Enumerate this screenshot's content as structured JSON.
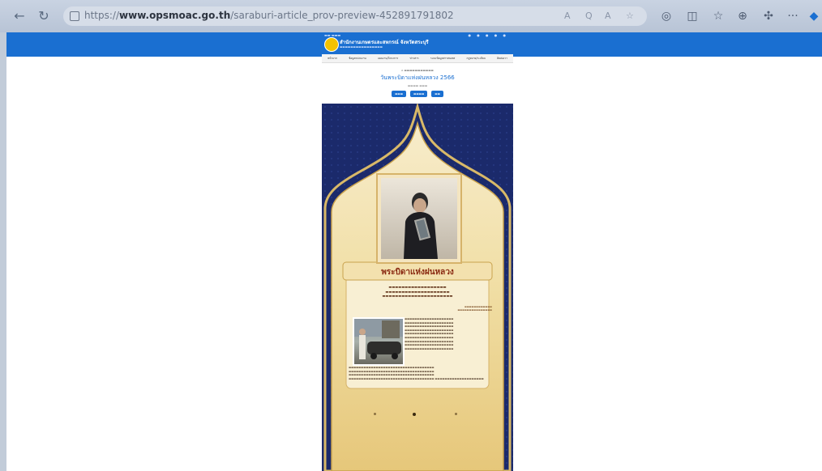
{
  "browser": {
    "url_prefix": "https://",
    "url_domain": "www.opsmoac.go.th",
    "url_path": "/saraburi-article_prov-preview-452891791802",
    "url_right_icons": [
      "A",
      "Q",
      "A",
      "☆"
    ],
    "toolbar_icons": [
      "back-icon",
      "refresh-icon",
      "tabs-icon",
      "split-icon",
      "favorites-icon",
      "collections-icon",
      "extensions-icon",
      "more-icon"
    ]
  },
  "site": {
    "title": "สำนักงานเกษตรและสหกรณ์ จังหวัดสระบุรี",
    "menu": [
      "หน้าแรก",
      "ข้อมูลหน่วยงาน",
      "แผนงาน/โครงการ",
      "ข่าวสาร",
      "ระบบข้อมูลสารสนเทศ",
      "กฎหมาย/ระเบียบ",
      "ติดต่อเรา"
    ]
  },
  "article": {
    "title": "วันพระบิดาแห่งฝนหลวง 2566"
  },
  "poster": {
    "title": "พระบิดาแห่งฝนหลวง"
  },
  "colors": {
    "browser_accent": "#1a6fd1",
    "poster_navy": "#1b2a6b",
    "poster_gold": "#d6b36a",
    "poster_title": "#8a2a12"
  }
}
